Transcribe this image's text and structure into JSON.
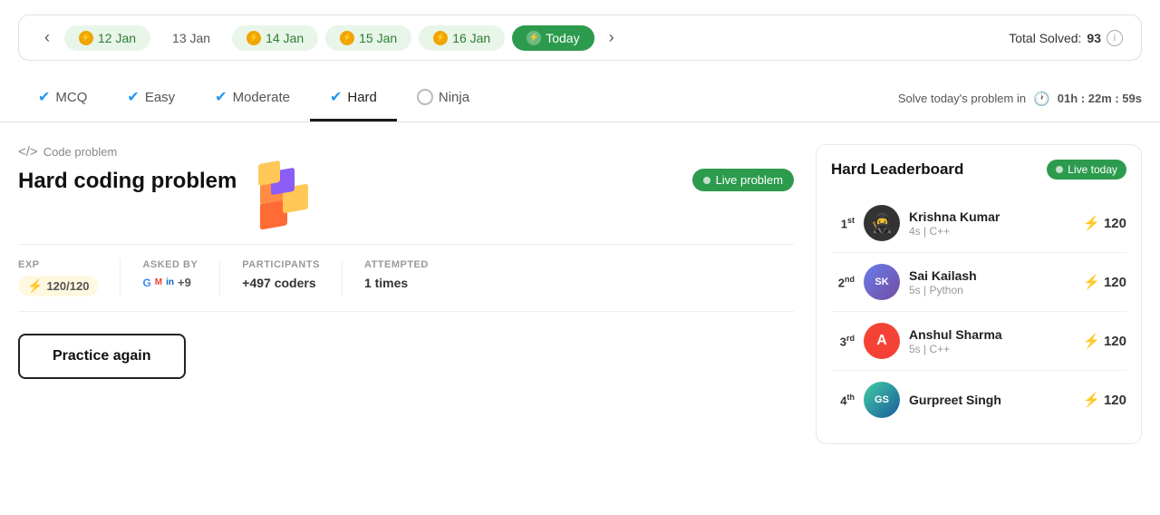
{
  "dateNav": {
    "prev_arrow": "‹",
    "next_arrow": "›",
    "dates": [
      {
        "label": "12 Jan",
        "state": "solved"
      },
      {
        "label": "13 Jan",
        "state": "unsolved"
      },
      {
        "label": "14 Jan",
        "state": "solved"
      },
      {
        "label": "15 Jan",
        "state": "solved"
      },
      {
        "label": "16 Jan",
        "state": "solved"
      },
      {
        "label": "Today",
        "state": "today"
      }
    ],
    "total_solved_label": "Total Solved:",
    "total_solved_value": "93"
  },
  "tabs": [
    {
      "label": "MCQ",
      "state": "checked"
    },
    {
      "label": "Easy",
      "state": "checked"
    },
    {
      "label": "Moderate",
      "state": "checked"
    },
    {
      "label": "Hard",
      "state": "active"
    },
    {
      "label": "Ninja",
      "state": "ninja"
    }
  ],
  "timer": {
    "prefix": "Solve today's problem in",
    "value": "01h : 22m : 59s"
  },
  "problem": {
    "type_label": "Code problem",
    "title": "Hard coding problem",
    "live_label": "Live problem",
    "meta": {
      "exp_label": "EXP",
      "exp_value": "120/120",
      "asked_label": "Asked by",
      "asked_extra": "+9",
      "participants_label": "Participants",
      "participants_value": "+497 coders",
      "attempted_label": "Attempted",
      "attempted_value": "1 times"
    },
    "practice_btn": "Practice again"
  },
  "leaderboard": {
    "title": "Hard Leaderboard",
    "live_label": "Live today",
    "entries": [
      {
        "rank": "1",
        "rank_suffix": "st",
        "name": "Krishna Kumar",
        "sub": "4s | C++",
        "score": "120",
        "avatar_type": "ninja"
      },
      {
        "rank": "2",
        "rank_suffix": "nd",
        "name": "Sai Kailash",
        "sub": "5s | Python",
        "score": "120",
        "avatar_type": "photo"
      },
      {
        "rank": "3",
        "rank_suffix": "rd",
        "name": "Anshul Sharma",
        "sub": "5s | C++",
        "score": "120",
        "avatar_type": "letter",
        "letter": "A"
      },
      {
        "rank": "4",
        "rank_suffix": "th",
        "name": "Gurpreet Singh",
        "sub": "",
        "score": "120",
        "avatar_type": "photo2"
      }
    ]
  },
  "colors": {
    "green": "#2d9b4e",
    "blue": "#2196f3",
    "gold": "#f0a500"
  }
}
